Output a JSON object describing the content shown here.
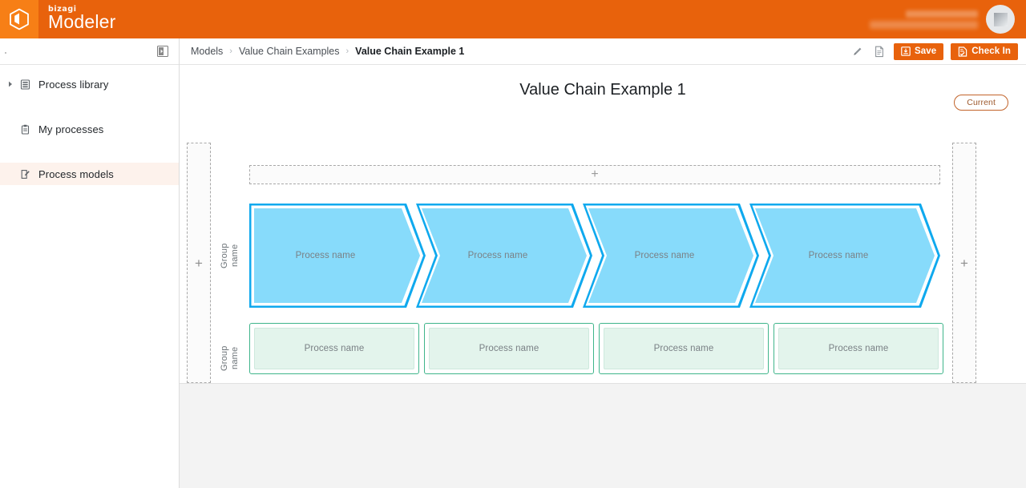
{
  "app": {
    "brand_sub": "bizagi",
    "brand_main": "Modeler",
    "logo_icon": "bizagi-cube-icon",
    "avatar_icon": "user-avatar",
    "brand_color": "#e8620c",
    "logo_tile_color": "#f77f16"
  },
  "sidebar": {
    "collapse_icon": "collapse-panel-icon",
    "items": [
      {
        "label": "Process library",
        "icon": "library-list-icon",
        "has_arrow": true,
        "active": false
      },
      {
        "label": "My processes",
        "icon": "clipboard-icon",
        "has_arrow": false,
        "active": false
      },
      {
        "label": "Process models",
        "icon": "edit-document-icon",
        "has_arrow": false,
        "active": true
      }
    ]
  },
  "breadcrumb": {
    "separator": "›",
    "items": [
      {
        "label": "Models",
        "current": false
      },
      {
        "label": "Value Chain Examples",
        "current": false
      },
      {
        "label": "Value Chain Example 1",
        "current": true
      }
    ]
  },
  "toolbar": {
    "edit_icon": "pencil-icon",
    "document_icon": "document-icon",
    "save_label": "Save",
    "save_icon": "save-disk-icon",
    "checkin_label": "Check In",
    "checkin_icon": "check-in-icon"
  },
  "canvas": {
    "title": "Value Chain Example 1",
    "status_badge": "Current",
    "add_row_top_label": "+",
    "add_column_left_label": "+",
    "add_column_right_label": "+"
  },
  "diagram": {
    "rows": [
      {
        "group_label": "Group\nname",
        "shape": "chevron",
        "accent_color": "#0fa9ee",
        "fill_color": "#87dbfb",
        "items": [
          {
            "label": "Process name"
          },
          {
            "label": "Process name"
          },
          {
            "label": "Process name"
          },
          {
            "label": "Process name"
          }
        ]
      },
      {
        "group_label": "Group\nname",
        "shape": "rectangle",
        "accent_color": "#3fb58b",
        "fill_color": "#e3f4ec",
        "items": [
          {
            "label": "Process name"
          },
          {
            "label": "Process name"
          },
          {
            "label": "Process name"
          },
          {
            "label": "Process name"
          }
        ]
      }
    ]
  }
}
